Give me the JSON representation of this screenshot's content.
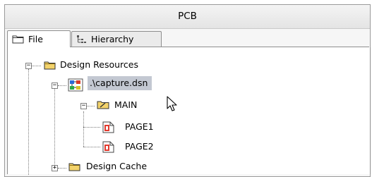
{
  "window": {
    "title": "PCB"
  },
  "tabs": [
    {
      "label": "File",
      "icon": "folder-icon",
      "active": true
    },
    {
      "label": "Hierarchy",
      "icon": "hierarchy-icon",
      "active": false
    }
  ],
  "tree": {
    "design_resources": {
      "label": "Design Resources",
      "icon": "folder-icon",
      "expanded": true
    },
    "capture_dsn": {
      "label": ".\\capture.dsn",
      "icon": "design-file-icon",
      "expanded": true,
      "selected": true
    },
    "main": {
      "label": "MAIN",
      "icon": "schematic-folder-icon",
      "expanded": true
    },
    "page1": {
      "label": "PAGE1",
      "icon": "page-icon"
    },
    "page2": {
      "label": "PAGE2",
      "icon": "page-icon"
    },
    "design_cache": {
      "label": "Design Cache",
      "icon": "folder-icon",
      "expanded": false
    }
  },
  "colors": {
    "selection": "#c3c8d2",
    "folder": "#f3d36b"
  }
}
